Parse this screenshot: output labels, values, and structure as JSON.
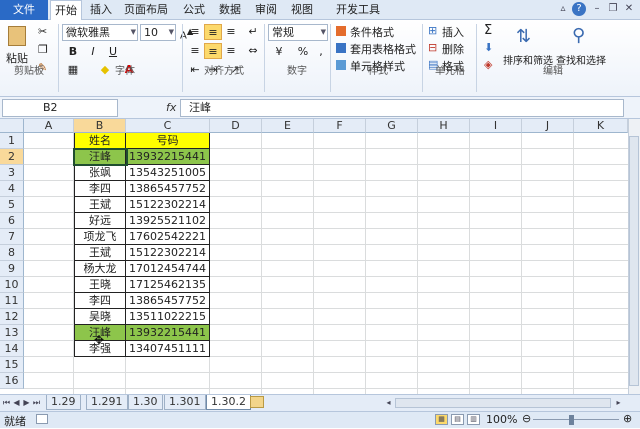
{
  "ribbon": {
    "tabs": [
      "文件",
      "开始",
      "插入",
      "页面布局",
      "公式",
      "数据",
      "审阅",
      "视图",
      "开发工具"
    ],
    "font": {
      "name": "微软雅黑",
      "size": "10"
    },
    "number_format": "常规",
    "buttons": {
      "paste": "粘贴",
      "conditional_format": "条件格式",
      "table_format": "套用表格格式",
      "cell_style": "单元格样式",
      "insert": "插入",
      "delete": "删除",
      "format": "格式",
      "sort_filter": "排序和筛选",
      "find_select": "查找和选择",
      "bold": "B",
      "italic": "I",
      "underline": "U",
      "sigma": "Σ"
    },
    "groups": [
      "剪贴板",
      "字体",
      "对齐方式",
      "数字",
      "样式",
      "单元格",
      "编辑"
    ]
  },
  "formula_bar": {
    "name_box": "B2",
    "fx": "fx",
    "content": "汪峰"
  },
  "grid": {
    "columns": [
      "A",
      "B",
      "C",
      "D",
      "E",
      "F",
      "G",
      "H",
      "I",
      "J",
      "K"
    ],
    "rows": [
      "1",
      "2",
      "3",
      "4",
      "5",
      "6",
      "7",
      "8",
      "9",
      "10",
      "11",
      "12",
      "13",
      "14",
      "15",
      "16"
    ],
    "header": {
      "name": "姓名",
      "number": "号码"
    },
    "records": [
      {
        "name": "汪峰",
        "number": "13932215441",
        "highlight": true
      },
      {
        "name": "张飒",
        "number": "13543251005",
        "highlight": false
      },
      {
        "name": "李四",
        "number": "13865457752",
        "highlight": false
      },
      {
        "name": "王斌",
        "number": "15122302214",
        "highlight": false
      },
      {
        "name": "好远",
        "number": "13925521102",
        "highlight": false
      },
      {
        "name": "项龙飞",
        "number": "17602542221",
        "highlight": false
      },
      {
        "name": "王斌",
        "number": "15122302214",
        "highlight": false
      },
      {
        "name": "杨大龙",
        "number": "17012454744",
        "highlight": false
      },
      {
        "name": "王晓",
        "number": "17125462135",
        "highlight": false
      },
      {
        "name": "李四",
        "number": "13865457752",
        "highlight": false
      },
      {
        "name": "吴晓",
        "number": "13511022215",
        "highlight": false
      },
      {
        "name": "汪峰",
        "number": "13932215441",
        "highlight": true
      },
      {
        "name": "李强",
        "number": "13407451111",
        "highlight": false
      }
    ],
    "colors": {
      "header_fill": "#ffff00",
      "duplicate_fill": "#8dc54b"
    }
  },
  "sheets": {
    "tabs": [
      "1.29",
      "1.291",
      "1.30",
      "1.301",
      "1.30.2"
    ],
    "active": "1.30.2"
  },
  "status": {
    "ready": "就绪",
    "zoom": "100%"
  }
}
